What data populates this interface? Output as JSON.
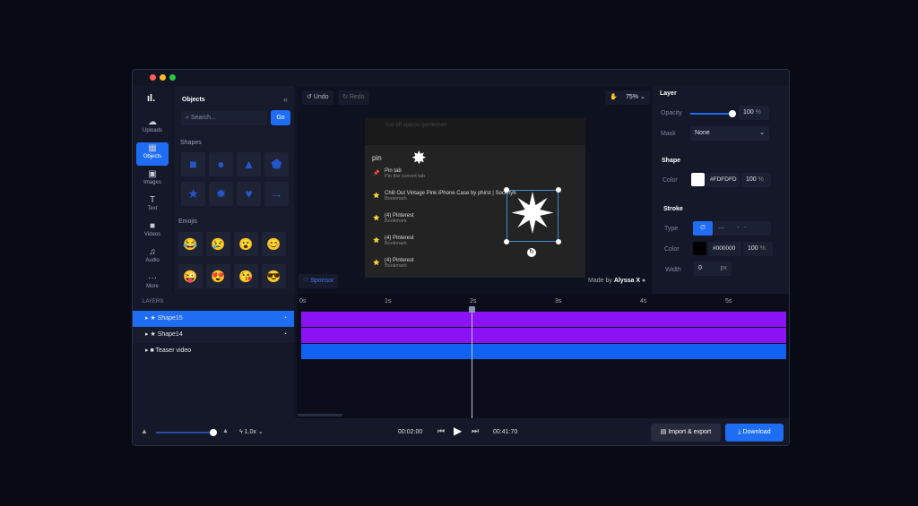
{
  "window": {
    "controls": [
      "#ff5f57",
      "#febc2e",
      "#28c840"
    ]
  },
  "rail": {
    "items": [
      {
        "label": "Uploads",
        "icon": "cloud-icon",
        "g": "☁"
      },
      {
        "label": "Objects",
        "icon": "grid-icon",
        "g": "▦"
      },
      {
        "label": "Images",
        "icon": "image-icon",
        "g": "▣"
      },
      {
        "label": "Text",
        "icon": "text-icon",
        "g": "T"
      },
      {
        "label": "Videos",
        "icon": "video-icon",
        "g": "■"
      },
      {
        "label": "Audio",
        "icon": "music-icon",
        "g": "♫"
      },
      {
        "label": "More",
        "icon": "more-icon",
        "g": "···"
      }
    ]
  },
  "objects": {
    "title": "Objects",
    "search_placeholder": "Search...",
    "go": "Go",
    "shapes_title": "Shapes",
    "shapes": [
      "■",
      "●",
      "▲",
      "⬟",
      "★",
      "✹",
      "♥",
      "→"
    ],
    "emojis_title": "Emojis",
    "emojis": [
      "😂",
      "😢",
      "😮",
      "😊",
      "😜",
      "😍",
      "😘",
      "😎"
    ]
  },
  "toolbar": {
    "undo": "Undo",
    "redo": "Redo",
    "zoom": "75%"
  },
  "preview": {
    "tweet": "Get off spaces gentlemen",
    "query": "pin",
    "results": [
      {
        "icon": "📌",
        "title": "Pin tab",
        "sub": "Pin the current tab"
      },
      {
        "icon": "⭐",
        "title": "Chill Out Vintage Pink iPhone Case by phirst | Society6",
        "sub": "Bookmark"
      },
      {
        "icon": "⭐",
        "title": "(4) Pinterest",
        "sub": "Bookmark"
      },
      {
        "icon": "⭐",
        "title": "(4) Pinterest",
        "sub": "Bookmark"
      },
      {
        "icon": "⭐",
        "title": "(4) Pinterest",
        "sub": "Bookmark"
      }
    ]
  },
  "sponsor": "Sponsor",
  "made_by": "Made by",
  "author": "Alyssa X",
  "props": {
    "layer": "Layer",
    "opacity_label": "Opacity",
    "opacity": "100",
    "opacity_value": 100,
    "pct": "%",
    "mask_label": "Mask",
    "mask": "None",
    "shape": "Shape",
    "color_label": "Color",
    "shape_color": "#FDFDFD",
    "shape_alpha": "100",
    "stroke": "Stroke",
    "type_label": "Type",
    "stroke_color": "#000000",
    "stroke_alpha": "100",
    "width_label": "Width",
    "width": "0",
    "px": "px"
  },
  "layers": {
    "title": "LAYERS",
    "items": [
      {
        "name": "Shape15",
        "selected": true
      },
      {
        "name": "Shape14",
        "selected": false
      },
      {
        "name": "Teaser video",
        "selected": false
      }
    ]
  },
  "timeline": {
    "ticks": [
      "0s",
      "1s",
      "2s",
      "3s",
      "4s",
      "5s"
    ],
    "playhead_seconds": 2,
    "bar_colors": [
      "#8b12f5",
      "#8b12f5",
      "#0f62f0"
    ]
  },
  "bottom": {
    "speed": "1.0x",
    "current": "00:02:00",
    "total": "00:41:70",
    "import": "Import & export",
    "download": "Download"
  }
}
